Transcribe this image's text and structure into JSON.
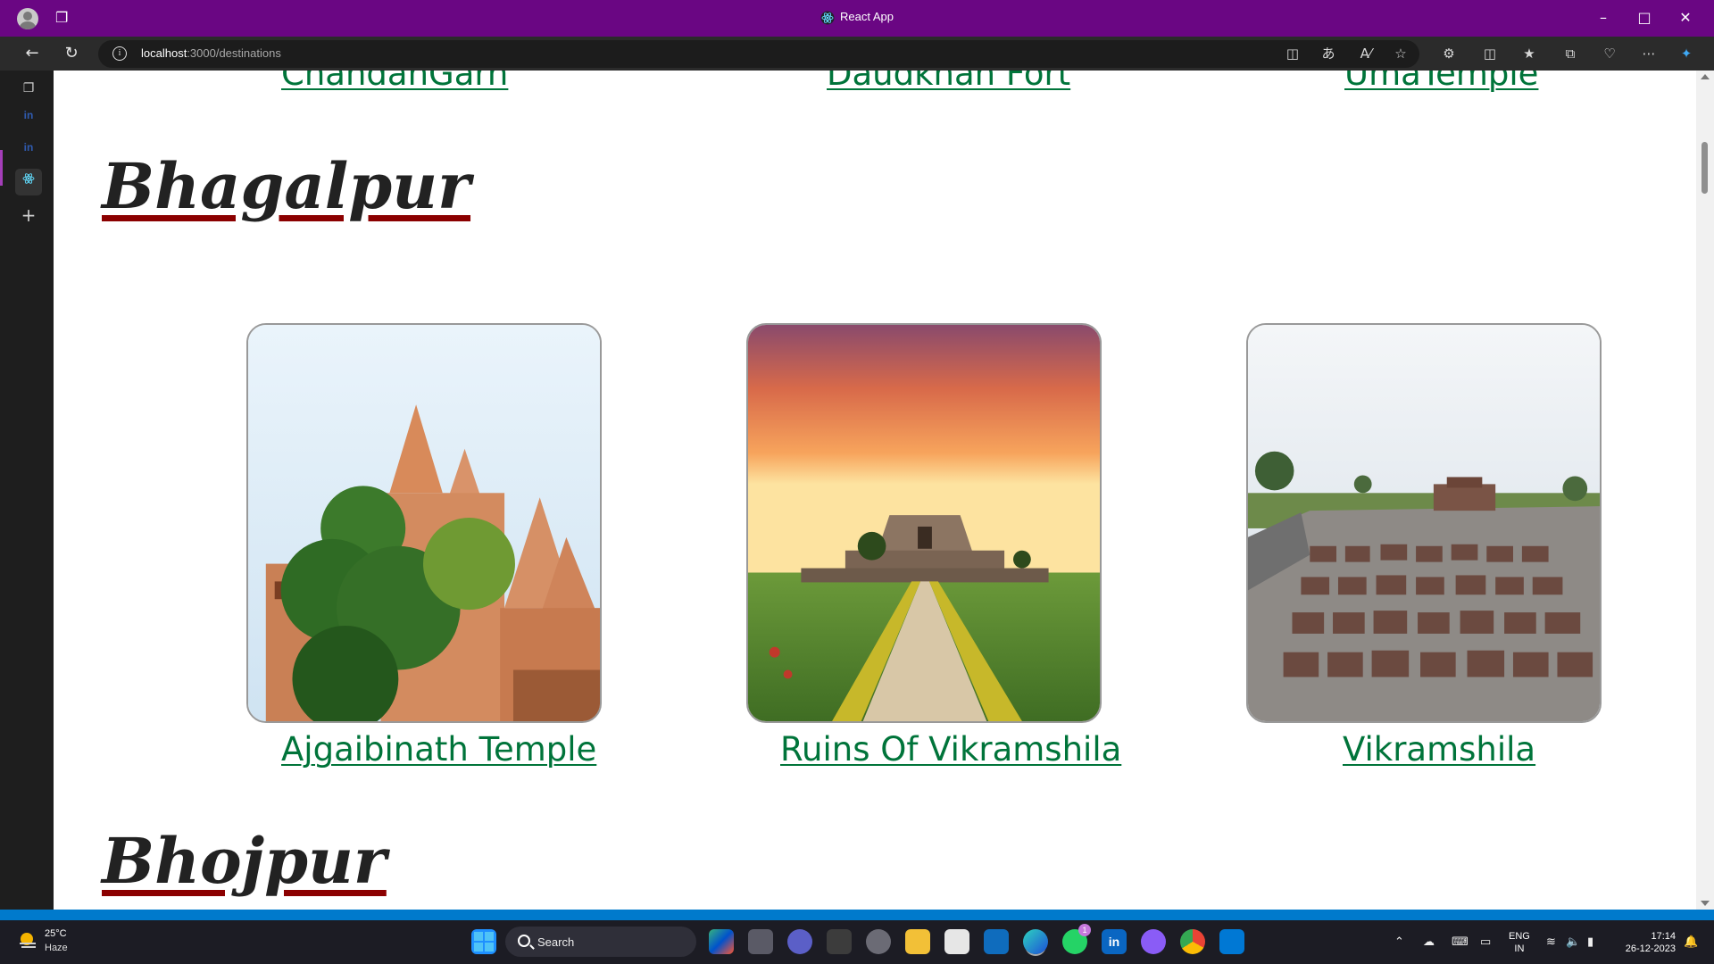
{
  "browser": {
    "window_title": "React App",
    "url_host": "localhost",
    "url_path": ":3000/destinations"
  },
  "page": {
    "top_links": [
      "ChandanGarh",
      "Daudkhan Fort",
      "UmaTemple"
    ],
    "sections": [
      {
        "city": "Bhagalpur",
        "destinations": [
          {
            "name": "Ajgaibinath Temple",
            "image": "temple-photo"
          },
          {
            "name": "Ruins Of Vikramshila",
            "image": "sunset-ruins-photo"
          },
          {
            "name": "Vikramshila",
            "image": "excavation-site-photo"
          }
        ]
      },
      {
        "city": "Bhojpur"
      }
    ]
  },
  "taskbar": {
    "weather_temp": "25°C",
    "weather_condition": "Haze",
    "search_label": "Search",
    "language_line1": "ENG",
    "language_line2": "IN",
    "time": "17:14",
    "date": "26-12-2023",
    "whatsapp_badge": "1"
  },
  "colors": {
    "titlebar": "#6a0683",
    "link": "#00743a",
    "heading_underline": "#8b0000"
  }
}
